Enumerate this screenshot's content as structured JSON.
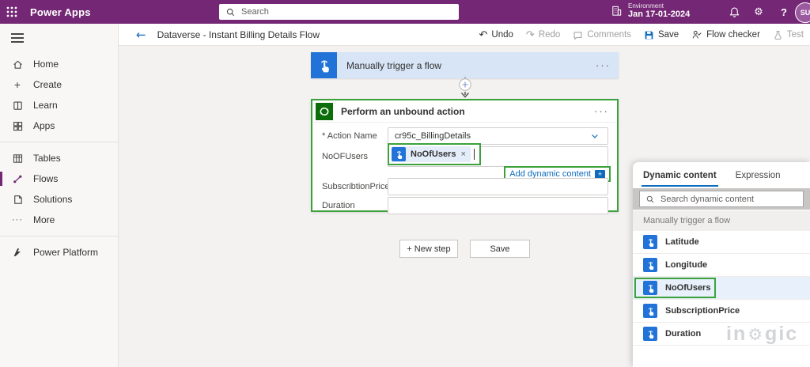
{
  "colors": {
    "topbar_purple": "#742774",
    "link_blue": "#0f6cbd",
    "trigger_blue": "#2173d8",
    "dataverse_green": "#0b6e0b",
    "highlight_green": "#3ba23b",
    "selected_row_blue": "#e7f0fb"
  },
  "icons": {
    "menu_ellipsis": "···",
    "back_arrow": "←",
    "undo_glyph": "↶",
    "redo_glyph": "↷",
    "help_glyph": "?",
    "gear_glyph": "⚙",
    "more_glyph": "···",
    "create_plus": "+",
    "token_close": "×",
    "adc_plus": "+"
  },
  "topbar": {
    "app_name": "Power Apps",
    "search_placeholder": "Search",
    "environment_label": "Environment",
    "environment_date": "Jan 17-01-2024",
    "avatar_initials": "SU"
  },
  "sidebar": {
    "items": [
      {
        "label": "Home"
      },
      {
        "label": "Create"
      },
      {
        "label": "Learn"
      },
      {
        "label": "Apps"
      },
      {
        "label": "Tables"
      },
      {
        "label": "Flows"
      },
      {
        "label": "Solutions"
      },
      {
        "label": "More"
      },
      {
        "label": "Power Platform"
      }
    ],
    "active_item": "Flows"
  },
  "flow_header": {
    "title": "Dataverse - Instant Billing Details Flow",
    "actions": [
      {
        "label": "Undo",
        "enabled": true
      },
      {
        "label": "Redo",
        "enabled": false
      },
      {
        "label": "Comments",
        "enabled": false
      },
      {
        "label": "Save",
        "enabled": true
      },
      {
        "label": "Flow checker",
        "enabled": true
      },
      {
        "label": "Test",
        "enabled": false
      }
    ]
  },
  "canvas": {
    "trigger_card": {
      "title": "Manually trigger a flow"
    },
    "action_card": {
      "title": "Perform an unbound action",
      "fields": [
        {
          "label": "* Action Name",
          "value": "cr95c_BillingDetails"
        },
        {
          "label": "NoOFUsers",
          "token": "NoOfUsers"
        },
        {
          "label": "SubscribtionPrice",
          "value": ""
        },
        {
          "label": "Duration",
          "value": ""
        }
      ],
      "add_dynamic_content": "Add dynamic content"
    },
    "new_step_button": "+ New step",
    "save_button": "Save"
  },
  "dynamic_panel": {
    "tabs": [
      {
        "label": "Dynamic content",
        "active": true
      },
      {
        "label": "Expression",
        "active": false
      }
    ],
    "search_placeholder": "Search dynamic content",
    "section_header": "Manually trigger a flow",
    "items": [
      {
        "label": "Latitude"
      },
      {
        "label": "Longitude"
      },
      {
        "label": "NoOfUsers"
      },
      {
        "label": "SubscriptionPrice"
      },
      {
        "label": "Duration"
      }
    ],
    "selected_item": "NoOfUsers",
    "watermark_left": "in",
    "watermark_right": "gic"
  }
}
